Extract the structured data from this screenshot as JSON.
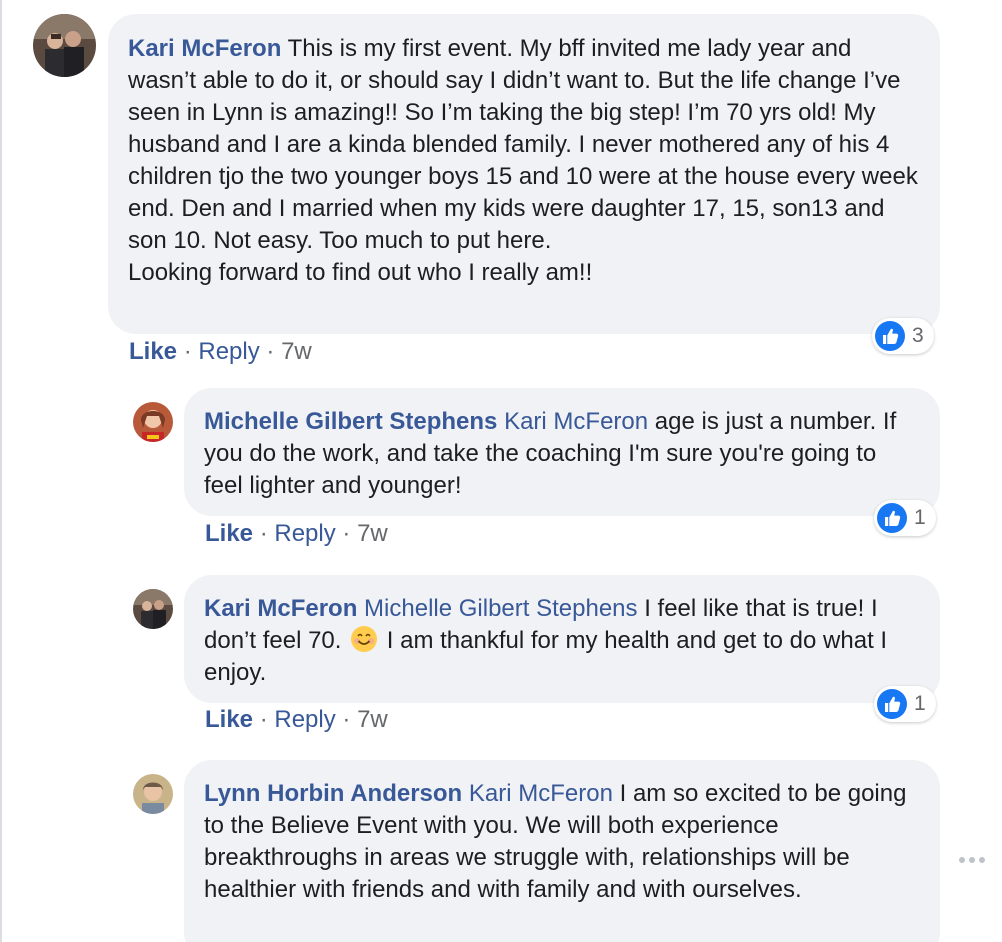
{
  "comments": [
    {
      "author": "Kari McFeron",
      "mention": "",
      "text": "This is my first event. My bff invited me lady year and wasn’t able to do it, or should say I didn’t want to. But the life change I’ve seen in Lynn is amazing!! So I’m taking the big step! I’m 70 yrs old! My husband and I are a kinda blended family. I never mothered any of his 4 children tjo the two younger boys 15 and 10 were at the house every week end. Den and I married when my kids were daughter 17, 15, son13 and son 10. Not easy. Too much to put here.",
      "text_line2": "Looking forward to find out who I really am!!",
      "like_label": "Like",
      "reply_label": "Reply",
      "separator": "·",
      "time": "7w",
      "reaction_count": "3"
    },
    {
      "author": "Michelle Gilbert Stephens",
      "mention": "Kari McFeron",
      "text": "age is just a number. If you do the work, and take the coaching I'm sure you're going to feel lighter and younger!",
      "like_label": "Like",
      "reply_label": "Reply",
      "separator": "·",
      "time": "7w",
      "reaction_count": "1"
    },
    {
      "author": "Kari McFeron",
      "mention": "Michelle Gilbert Stephens",
      "text_before_emoji": "I feel like that is true! I don’t feel 70.",
      "text_after_emoji": "I am thankful for my health and get to do what I enjoy.",
      "emoji": "smiling-face-icon",
      "like_label": "Like",
      "reply_label": "Reply",
      "separator": "·",
      "time": "7w",
      "reaction_count": "1"
    },
    {
      "author": "Lynn Horbin Anderson",
      "mention": "Kari McFeron",
      "text": "I am so excited to be going to the Believe Event with you. We will both experience breakthroughs in areas we struggle with, relationships will be healthier with friends and with family and with ourselves."
    }
  ],
  "colors": {
    "name_blue": "#385898",
    "bubble_bg": "#f0f2f5",
    "meta_gray": "#65676b",
    "like_blue": "#1877f2"
  },
  "icons": {
    "reaction": "thumbs-up-icon",
    "more": "more-options-icon"
  }
}
